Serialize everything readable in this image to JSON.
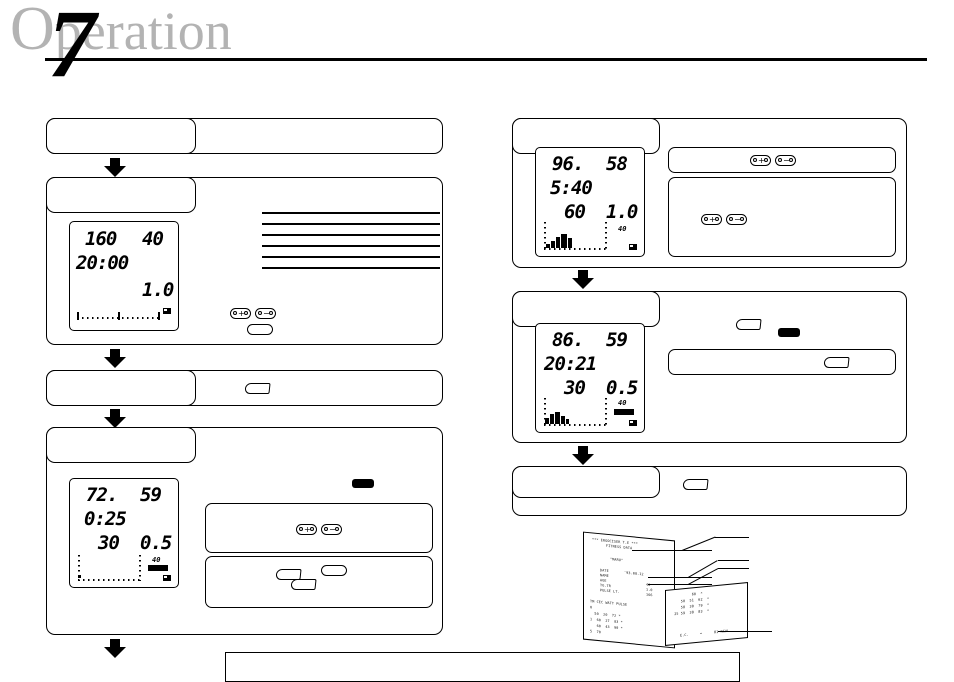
{
  "header": {
    "chapter_word_cap": "O",
    "chapter_word_rest": "peration",
    "chapter_number": "7"
  },
  "left_column": {
    "step1": {
      "title": "",
      "body": ""
    },
    "step2": {
      "title": "",
      "body": "",
      "lcd": {
        "line1_left": "160",
        "line1_right": "40",
        "line2": "20:00",
        "line3_right": "1.0",
        "ruler_ticks": 14
      },
      "controls": {
        "plus_label": "+",
        "minus_label": "−",
        "round_button_label": ""
      },
      "note_lines": 6
    },
    "step3": {
      "title": "",
      "body": "",
      "pointer_icon": "teardrop-button-icon"
    },
    "step4": {
      "title": "",
      "lcd": {
        "line1_left": "72.",
        "line1_right": "59",
        "line2": "0:25",
        "line3_left": "30",
        "line3_right": "0.5",
        "level_label": "40"
      },
      "subpanel_a": {
        "text": "",
        "plus_label": "+",
        "minus_label": "−"
      },
      "subpanel_b": {
        "text": "",
        "round_button_label": ""
      }
    }
  },
  "right_column": {
    "step5": {
      "title": "",
      "lcd": {
        "line1_left": "96.",
        "line1_right": "58",
        "line2": "5:40",
        "line3_left": "60",
        "line3_right": "1.0",
        "level_label": "40",
        "bars": [
          1,
          2,
          4,
          5,
          3
        ]
      },
      "subpanel_a": {
        "text": "",
        "plus_label": "+",
        "minus_label": "−"
      },
      "subpanel_b": {
        "text": "",
        "plus_label": "+",
        "minus_label": "−"
      }
    },
    "step6": {
      "title": "",
      "lcd": {
        "line1_left": "86.",
        "line1_right": "59",
        "line2": "20:21",
        "line3_left": "30",
        "line3_right": "0.5",
        "level_label": "40",
        "bars": [
          2,
          4,
          5,
          3,
          2,
          1
        ]
      },
      "subpanel": {
        "text": ""
      }
    },
    "step7": {
      "title": "",
      "body": ""
    }
  },
  "printout": {
    "title_line1": "*** ERGOCISER T.E ***",
    "title_line2": "FITNESS DATA",
    "subject": "\"MARU\"",
    "fields": [
      {
        "label": "DATE",
        "value": "'93.08.12"
      },
      {
        "label": "NAME",
        "value": ""
      },
      {
        "label": "AGE",
        "value": "40"
      },
      {
        "label": "TG.TR",
        "value": "1.0"
      },
      {
        "label": "PULSE LT.",
        "value": "166"
      }
    ],
    "table_header": "TM CEC WATT PULSE",
    "table_rows": [
      "0",
      "  50  20  72 *",
      "1  60  27  83 *",
      "   60  43  90 *",
      "5  70"
    ],
    "overlay_rows": [
      "         60  *",
      "    50  51  62  *",
      "    58  30  79  *",
      " 25 59  38  83  *"
    ],
    "total_label": "E.C.",
    "total_eq": "=",
    "total_value": "81 KCAL"
  },
  "bottom_box": {
    "text": ""
  }
}
